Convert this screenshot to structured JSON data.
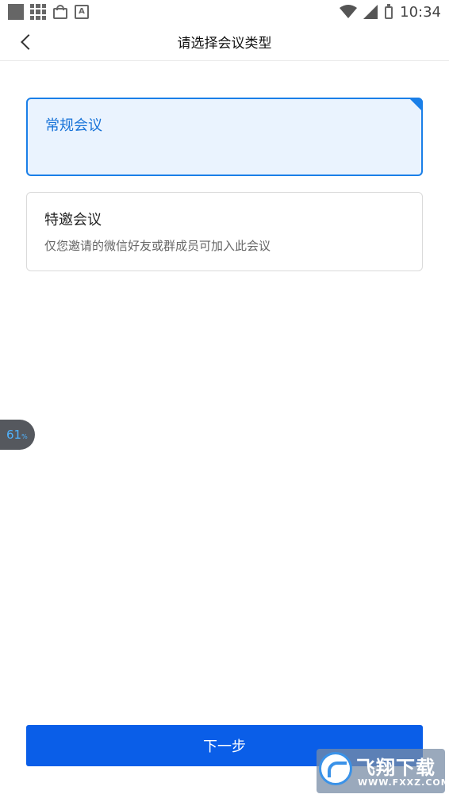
{
  "status_bar": {
    "time": "10:34",
    "left_icons": [
      "stop-icon",
      "grid-icon",
      "shopping-bag-icon",
      "a-icon"
    ],
    "right_icons": [
      "wifi-icon",
      "signal-icon",
      "battery-icon"
    ]
  },
  "nav": {
    "title": "请选择会议类型",
    "back_icon": "back-chevron-icon"
  },
  "options": [
    {
      "title": "常规会议",
      "selected": true
    },
    {
      "title": "特邀会议",
      "description": "仅您邀请的微信好友或群成员可加入此会议",
      "selected": false
    }
  ],
  "float_badge": {
    "value": "61",
    "unit": "%"
  },
  "next_button": {
    "label": "下一步"
  },
  "watermark": {
    "text": "飞翔下载",
    "domain": "WWW.FXXZ.COM"
  },
  "colors": {
    "accent": "#0a5ee8",
    "selected_border": "#1a7fe8",
    "selected_bg": "#eaf3fe",
    "selected_text": "#1873d8"
  }
}
